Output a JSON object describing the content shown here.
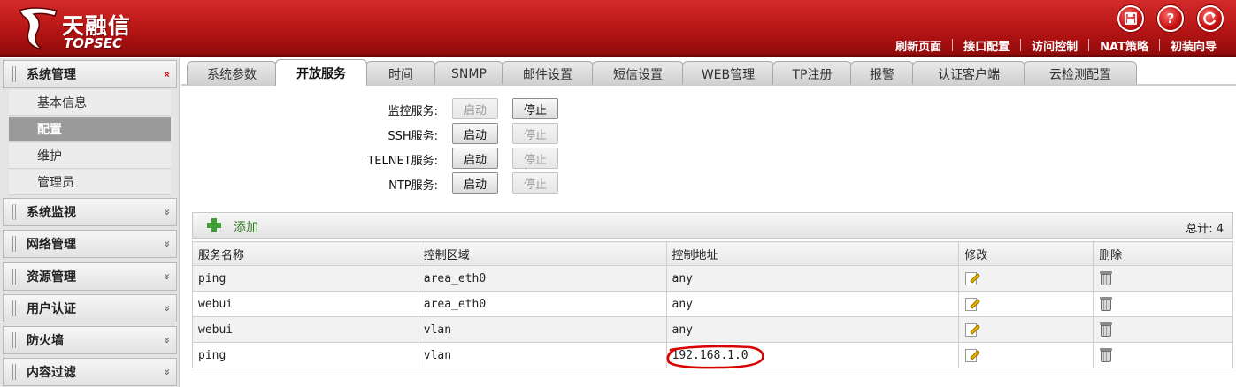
{
  "header": {
    "logo_cn": "天融信",
    "logo_en": "TOPSEC",
    "icons": [
      "save-icon",
      "help-icon",
      "logout-icon"
    ],
    "nav": [
      "刷新页面",
      "接口配置",
      "访问控制",
      "NAT策略",
      "初装向导"
    ]
  },
  "sidebar": {
    "groups": [
      {
        "label": "系统管理",
        "expanded": true
      },
      {
        "label": "系统监视",
        "expanded": false
      },
      {
        "label": "网络管理",
        "expanded": false
      },
      {
        "label": "资源管理",
        "expanded": false
      },
      {
        "label": "用户认证",
        "expanded": false
      },
      {
        "label": "防火墙",
        "expanded": false
      },
      {
        "label": "内容过滤",
        "expanded": false
      }
    ],
    "items": [
      "基本信息",
      "配置",
      "维护",
      "管理员"
    ],
    "active_item": "配置",
    "chevron_up": "«",
    "chevron_down": "»"
  },
  "tabs": [
    "系统参数",
    "开放服务",
    "时间",
    "SNMP",
    "邮件设置",
    "短信设置",
    "WEB管理",
    "TP注册",
    "报警",
    "认证客户端",
    "云检测配置"
  ],
  "active_tab": "开放服务",
  "services": [
    {
      "label": "监控服务:",
      "start": "启动",
      "stop": "停止",
      "running": true
    },
    {
      "label": "SSH服务:",
      "start": "启动",
      "stop": "停止",
      "running": false
    },
    {
      "label": "TELNET服务:",
      "start": "启动",
      "stop": "停止",
      "running": false
    },
    {
      "label": "NTP服务:",
      "start": "启动",
      "stop": "停止",
      "running": false
    }
  ],
  "toolbar": {
    "add_label": "添加",
    "total_label": "总计: 4"
  },
  "table": {
    "headers": [
      "服务名称",
      "控制区域",
      "控制地址",
      "修改",
      "删除"
    ],
    "rows": [
      [
        "ping",
        "area_eth0",
        "any"
      ],
      [
        "webui",
        "area_eth0",
        "any"
      ],
      [
        "webui",
        "vlan",
        "any"
      ],
      [
        "ping",
        "vlan",
        "192.168.1.0"
      ]
    ]
  },
  "colors": {
    "header_red": "#b51414",
    "annotation_red": "#d80000",
    "add_green": "#3f9f37"
  }
}
